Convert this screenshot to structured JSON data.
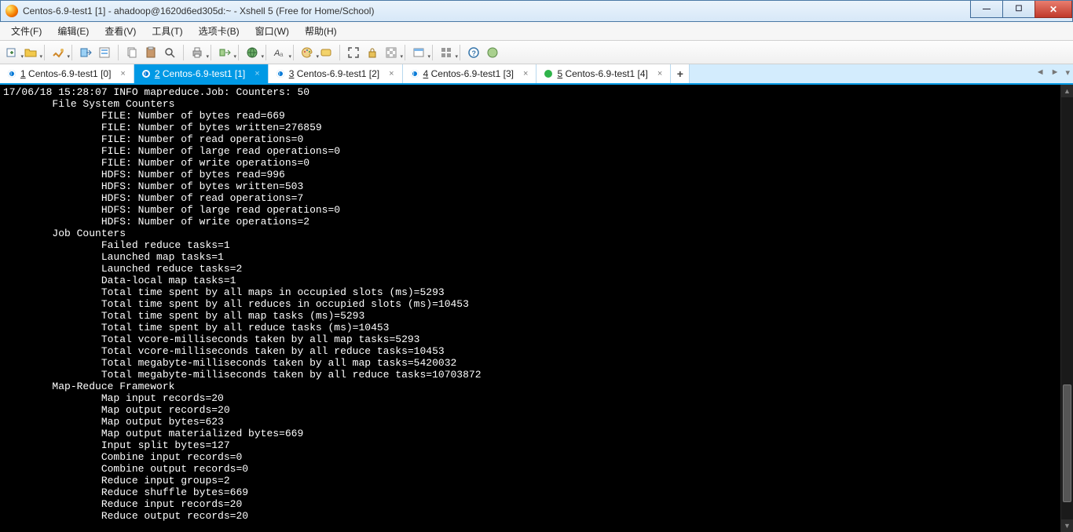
{
  "window": {
    "title": "Centos-6.9-test1 [1] - ahadoop@1620d6ed305d:~ - Xshell 5 (Free for Home/School)"
  },
  "menu": {
    "file": "文件(F)",
    "edit": "编辑(E)",
    "view": "查看(V)",
    "tools": "工具(T)",
    "tabs": "选项卡(B)",
    "window": "窗口(W)",
    "help": "帮助(H)"
  },
  "tabs": [
    {
      "indicator": "info",
      "num": "1",
      "label": "Centos-6.9-test1 [0]"
    },
    {
      "indicator": "info",
      "num": "2",
      "label": "Centos-6.9-test1 [1]",
      "active": true
    },
    {
      "indicator": "info",
      "num": "3",
      "label": "Centos-6.9-test1 [2]"
    },
    {
      "indicator": "info",
      "num": "4",
      "label": "Centos-6.9-test1 [3]"
    },
    {
      "indicator": "green",
      "num": "5",
      "label": "Centos-6.9-test1 [4]"
    }
  ],
  "terminal": "17/06/18 15:28:07 INFO mapreduce.Job: Counters: 50\n        File System Counters\n                FILE: Number of bytes read=669\n                FILE: Number of bytes written=276859\n                FILE: Number of read operations=0\n                FILE: Number of large read operations=0\n                FILE: Number of write operations=0\n                HDFS: Number of bytes read=996\n                HDFS: Number of bytes written=503\n                HDFS: Number of read operations=7\n                HDFS: Number of large read operations=0\n                HDFS: Number of write operations=2\n        Job Counters \n                Failed reduce tasks=1\n                Launched map tasks=1\n                Launched reduce tasks=2\n                Data-local map tasks=1\n                Total time spent by all maps in occupied slots (ms)=5293\n                Total time spent by all reduces in occupied slots (ms)=10453\n                Total time spent by all map tasks (ms)=5293\n                Total time spent by all reduce tasks (ms)=10453\n                Total vcore-milliseconds taken by all map tasks=5293\n                Total vcore-milliseconds taken by all reduce tasks=10453\n                Total megabyte-milliseconds taken by all map tasks=5420032\n                Total megabyte-milliseconds taken by all reduce tasks=10703872\n        Map-Reduce Framework\n                Map input records=20\n                Map output records=20\n                Map output bytes=623\n                Map output materialized bytes=669\n                Input split bytes=127\n                Combine input records=0\n                Combine output records=0\n                Reduce input groups=2\n                Reduce shuffle bytes=669\n                Reduce input records=20\n                Reduce output records=20"
}
